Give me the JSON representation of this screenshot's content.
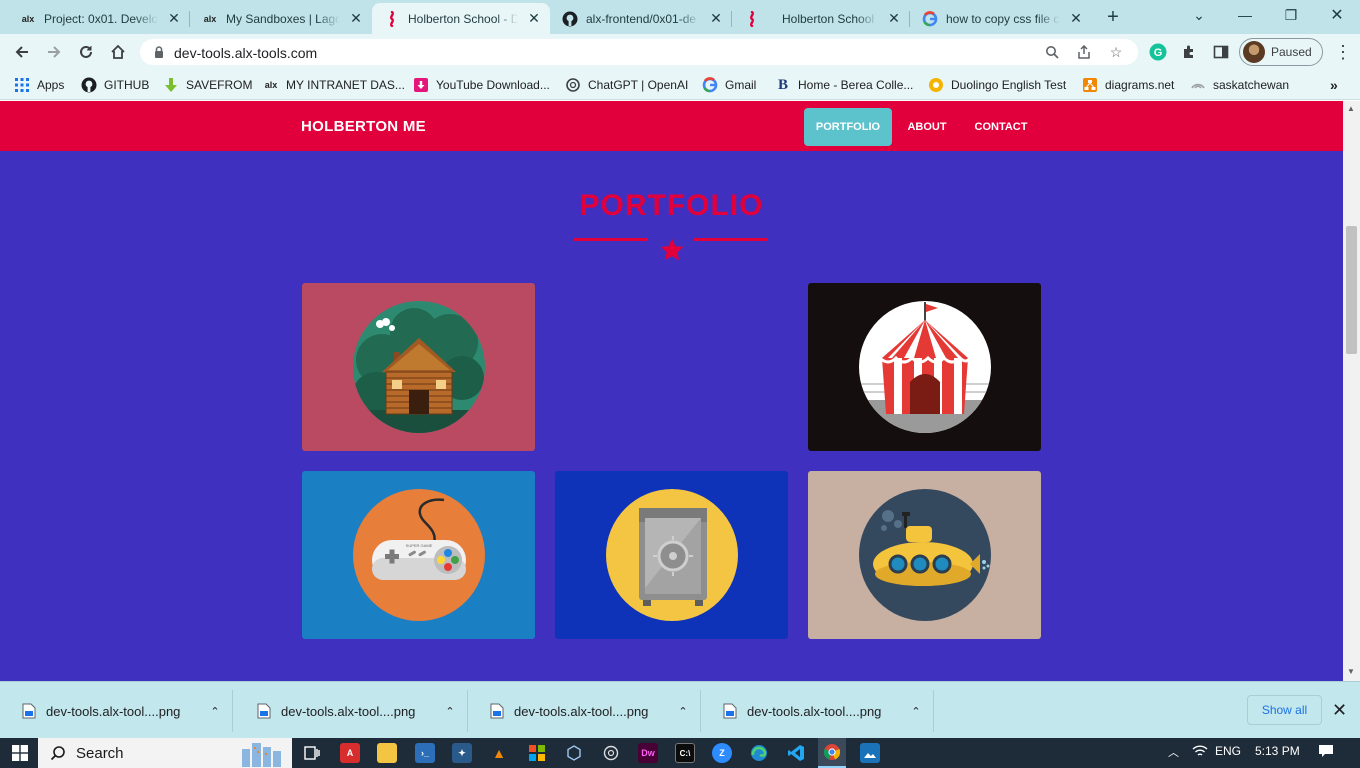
{
  "browser": {
    "tabs": [
      {
        "title": "Project: 0x01. Develop",
        "favicon": "alx-icon",
        "active": false
      },
      {
        "title": "My Sandboxes | Lagos",
        "favicon": "alx-icon",
        "active": false
      },
      {
        "title": "Holberton School - De",
        "favicon": "holberton-icon",
        "active": true
      },
      {
        "title": "alx-frontend/0x01-de",
        "favicon": "github-icon",
        "active": false
      },
      {
        "title": "Holberton School - De",
        "favicon": "holberton-icon",
        "active": false
      },
      {
        "title": "how to copy css file c",
        "favicon": "google-icon",
        "active": false
      }
    ],
    "url": "dev-tools.alx-tools.com",
    "profile_label": "Paused",
    "bookmarks": [
      {
        "label": "Apps",
        "icon": "apps-grid-icon"
      },
      {
        "label": "GITHUB",
        "icon": "github-icon"
      },
      {
        "label": "SAVEFROM",
        "icon": "savefrom-icon"
      },
      {
        "label": "MY INTRANET DAS...",
        "icon": "alx-icon"
      },
      {
        "label": "YouTube Download...",
        "icon": "youtube-download-icon"
      },
      {
        "label": "ChatGPT | OpenAI",
        "icon": "openai-icon"
      },
      {
        "label": "Gmail",
        "icon": "google-icon"
      },
      {
        "label": "Home - Berea Colle...",
        "icon": "berea-icon"
      },
      {
        "label": "Duolingo English Test",
        "icon": "duolingo-icon"
      },
      {
        "label": "diagrams.net",
        "icon": "diagrams-icon"
      },
      {
        "label": "saskatchewan",
        "icon": "globe-icon"
      }
    ]
  },
  "site": {
    "brand": "HOLBERTON ME",
    "nav": [
      {
        "label": "PORTFOLIO",
        "active": true
      },
      {
        "label": "ABOUT",
        "active": false
      },
      {
        "label": "CONTACT",
        "active": false
      }
    ],
    "section_title": "PORTFOLIO",
    "colors": {
      "header": "#e1003c",
      "body": "#4030c0",
      "active_nav": "#5cc3cd"
    },
    "portfolio": [
      {
        "name": "cabin",
        "bg": "#b94a62"
      },
      {
        "name": "circus-tent",
        "bg": "#140e0e"
      },
      {
        "name": "game-controller",
        "bg": "#1b7fc4"
      },
      {
        "name": "safe",
        "bg": "#0f33b8"
      },
      {
        "name": "submarine",
        "bg": "#c7afa2"
      }
    ]
  },
  "downloads": {
    "items": [
      {
        "filename": "dev-tools.alx-tool....png"
      },
      {
        "filename": "dev-tools.alx-tool....png"
      },
      {
        "filename": "dev-tools.alx-tool....png"
      },
      {
        "filename": "dev-tools.alx-tool....png"
      }
    ],
    "show_all_label": "Show all"
  },
  "taskbar": {
    "search_label": "Search",
    "language": "ENG",
    "time": "5:13 PM"
  }
}
